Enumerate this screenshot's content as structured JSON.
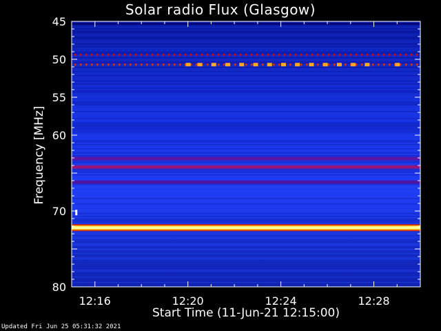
{
  "chart_data": {
    "type": "heatmap",
    "title": "Solar radio Flux (Glasgow)",
    "xlabel": "Start Time (11-Jun-21 12:15:00)",
    "ylabel": "Frequency [MHz]",
    "x_ticks": [
      "12:16",
      "12:20",
      "12:24",
      "12:28"
    ],
    "x_tick_minutes": [
      1,
      5,
      9,
      13
    ],
    "xlim_minutes": [
      0,
      15
    ],
    "y_ticks": [
      45,
      50,
      55,
      60,
      65,
      70,
      75,
      80
    ],
    "y_tick_labels": [
      "45",
      "50",
      "55",
      "60",
      "",
      "70",
      "",
      "80"
    ],
    "ylim": [
      45,
      80
    ],
    "colormap": [
      "#0000a0",
      "#0033ff",
      "#cc0044",
      "#ff8800",
      "#ffffaa"
    ],
    "bands": [
      {
        "freq": 72.2,
        "intensity": "very-high",
        "color": "#ffff99"
      },
      {
        "freq": 64.2,
        "intensity": "medium",
        "color": "#aa1166"
      },
      {
        "freq": 63.1,
        "intensity": "low-medium",
        "color": "#661199"
      },
      {
        "freq": 66.2,
        "intensity": "low-medium",
        "color": "#551199"
      },
      {
        "freq": 49.4,
        "intensity": "medium-dots",
        "color": "#cc1111"
      },
      {
        "freq": 50.7,
        "intensity": "medium-dots",
        "color": "#dd3311"
      }
    ],
    "bursts": [
      {
        "freq": 50.7,
        "minutes": [
          5.0,
          5.5,
          6.1,
          6.7,
          7.3,
          7.9,
          8.5,
          9.1,
          9.7,
          10.3,
          10.9,
          11.5,
          12.1,
          12.7,
          14.0
        ],
        "color": "#ffaa22"
      }
    ],
    "spike": {
      "freq": 70.2,
      "minute": 0.2,
      "color": "#ffffff"
    }
  },
  "footer": {
    "updated": "Updated Fri Jun 25 05:31:32 2021"
  }
}
